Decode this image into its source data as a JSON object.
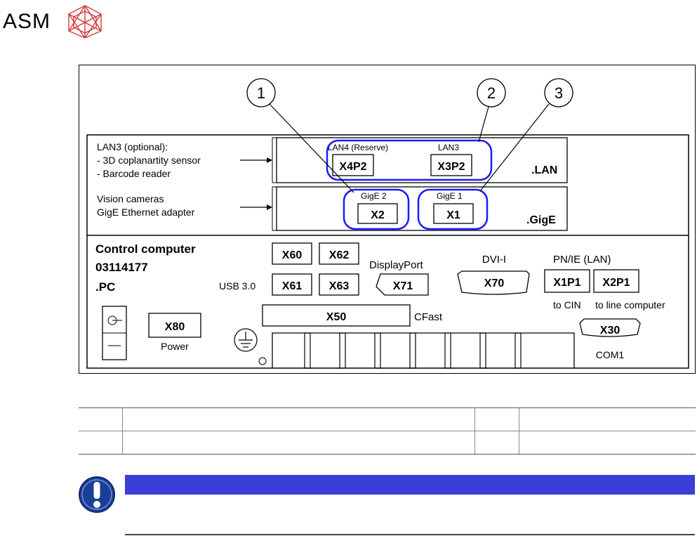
{
  "header": {
    "logo_text": "ASM"
  },
  "diagram": {
    "callouts": [
      "1",
      "2",
      "3"
    ],
    "left_labels": {
      "lan3_title": "LAN3 (optional):",
      "lan3_item1": "- 3D coplanartity sensor",
      "lan3_item2": "- Barcode reader",
      "vision1": "Vision cameras",
      "vision2": "GigE Ethernet adapter"
    },
    "lan_module": {
      "port1_label": "LAN4 (Reserve)",
      "port2_label": "LAN3",
      "port1": "X4P2",
      "port2": "X3P2",
      "name": ".LAN"
    },
    "gige_module": {
      "port1_label": "GigE 2",
      "port2_label": "GigE 1",
      "port1": "X2",
      "port2": "X1",
      "name": ".GigE"
    },
    "pc": {
      "title": "Control computer",
      "part_number": "03114177",
      "name": ".PC",
      "usb_label": "USB 3.0",
      "usb_ports": [
        "X60",
        "X62",
        "X61",
        "X63"
      ],
      "displayport_label": "DisplayPort",
      "displayport": "X71",
      "dvi_label": "DVI-I",
      "dvi": "X70",
      "lan_label": "PN/IE (LAN)",
      "lan_ports": [
        "X1P1",
        "X2P1"
      ],
      "lan_sub1": "to CIN",
      "lan_sub2": "to line computer",
      "cfast": "X50",
      "cfast_label": "CFast",
      "power": "X80",
      "power_label": "Power",
      "com": "X30",
      "com_label": "COM1"
    },
    "highlight_color": "#1a1aff"
  },
  "legend_table": {
    "rows": [
      [
        "",
        "",
        "",
        ""
      ],
      [
        "",
        "",
        "",
        ""
      ]
    ]
  },
  "notice": {
    "icon": "exclamation-icon",
    "bar_color": "#3d3dd7"
  }
}
